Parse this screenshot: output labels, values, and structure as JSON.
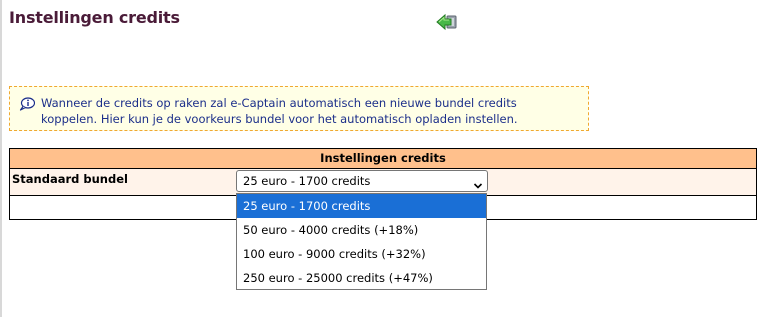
{
  "page": {
    "title": "Instellingen credits"
  },
  "info": {
    "line1": "Wanneer de credits op raken zal e-Captain automatisch een nieuwe bundel credits",
    "line2": "koppelen. Hier kun je de voorkeurs bundel voor het automatisch opladen instellen."
  },
  "table": {
    "header": "Instellingen credits",
    "row_label": "Standaard bundel"
  },
  "select": {
    "current_value": "25 euro - 1700 credits",
    "options": [
      "25 euro - 1700 credits",
      "50 euro - 4000 credits (+18%)",
      "100 euro - 9000 credits (+32%)",
      "250 euro - 25000 credits (+47%)"
    ],
    "selected_index": 0
  },
  "colors": {
    "title": "#4a1b38",
    "info_text": "#1c2f8a",
    "info_bg": "#ffffe6",
    "info_border": "#f0a830",
    "table_header_bg": "#ffc08c",
    "table_row_bg": "#fff3ea",
    "option_selected_bg": "#1a6fd6"
  },
  "icons": {
    "back": "back-arrow-icon",
    "info": "info-icon",
    "dropdown": "chevron-down-icon"
  }
}
